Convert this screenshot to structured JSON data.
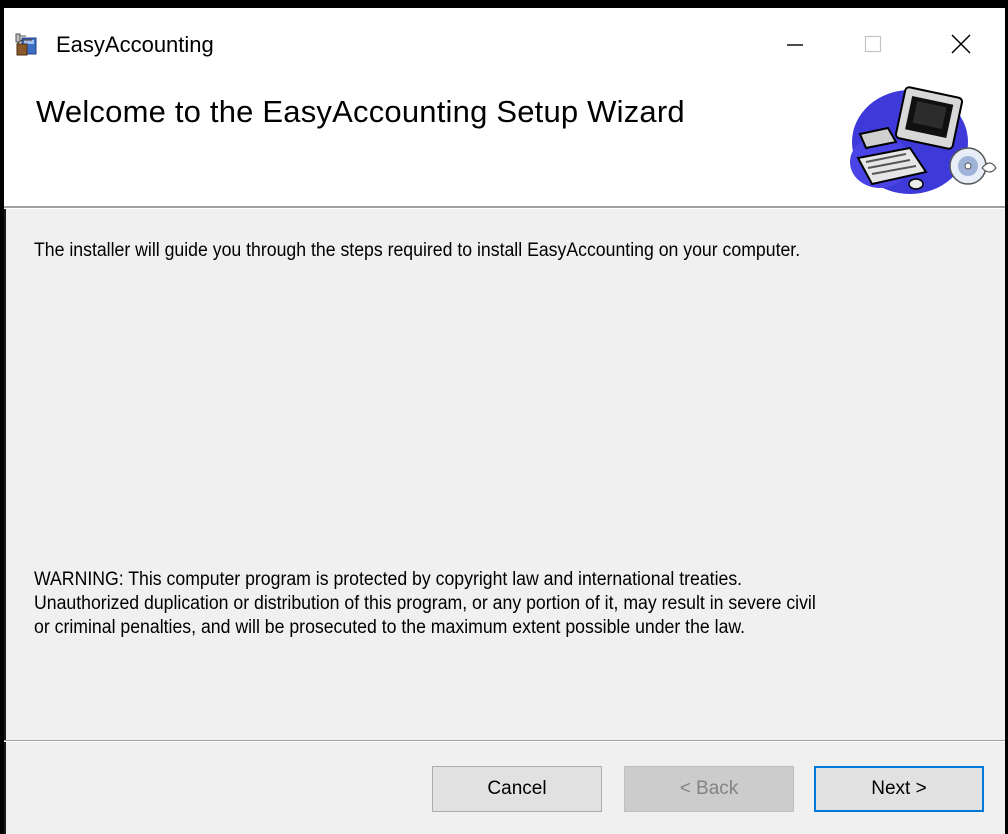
{
  "window": {
    "title": "EasyAccounting",
    "icon": "installer-box-icon",
    "controls": {
      "minimize": "minimize-icon",
      "maximize": "maximize-icon",
      "close": "close-icon"
    }
  },
  "header": {
    "title": "Welcome to the EasyAccounting Setup Wizard",
    "graphic": "computer-with-cd-icon"
  },
  "content": {
    "intro": "The installer will guide you through the steps required to install EasyAccounting on your computer.",
    "warning_lines": [
      "WARNING: This computer program is protected by copyright law and international treaties.",
      "Unauthorized duplication or distribution of this program, or any portion of it, may result in severe civil",
      "or criminal penalties, and will be prosecuted to the maximum extent possible under the law."
    ]
  },
  "buttons": {
    "cancel": "Cancel",
    "back": "< Back",
    "next": "Next >"
  },
  "colors": {
    "accent": "#0078d7",
    "header_bg": "#ffffff",
    "body_bg": "#f0f0f0"
  }
}
